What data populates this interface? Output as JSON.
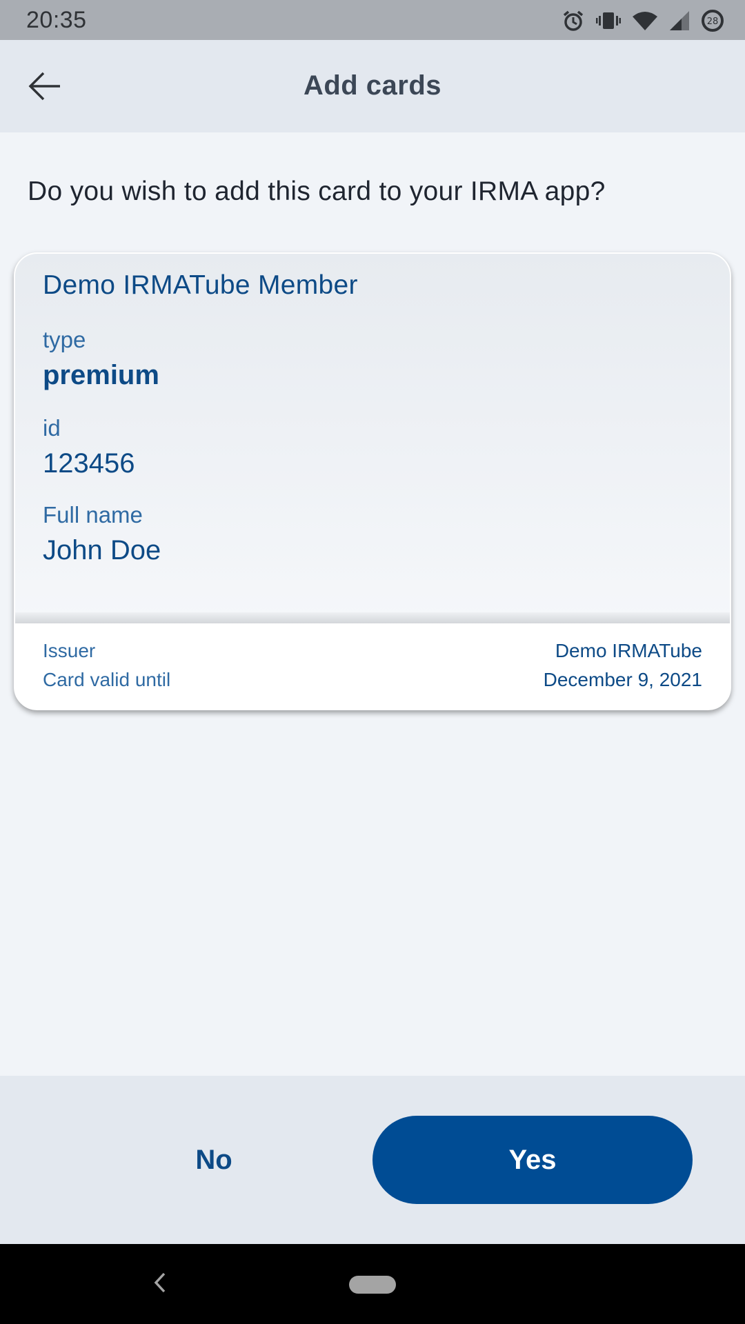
{
  "status_bar": {
    "time": "20:35",
    "icons": [
      "alarm-icon",
      "vibrate-icon",
      "wifi-icon",
      "signal-icon",
      "battery-icon"
    ],
    "battery_level": "28"
  },
  "app_bar": {
    "title": "Add cards",
    "back_icon": "arrow-left-icon"
  },
  "question": "Do you wish to add this card to your IRMA app?",
  "card": {
    "title": "Demo IRMATube Member",
    "attributes": [
      {
        "label": "type",
        "value": "premium"
      },
      {
        "label": "id",
        "value": "123456"
      },
      {
        "label": "Full name",
        "value": "John Doe"
      }
    ],
    "issuer_label": "Issuer",
    "issuer_value": "Demo IRMATube",
    "valid_label": "Card valid until",
    "valid_value": "December 9, 2021"
  },
  "actions": {
    "no_label": "No",
    "yes_label": "Yes"
  },
  "nav": {
    "back_icon": "nav-back-icon",
    "home_icon": "nav-home-pill"
  },
  "colors": {
    "primary": "#004c94",
    "text_blue": "#0d4a86",
    "label_blue": "#2f6aa3",
    "app_bar_bg": "#e3e8ef",
    "page_bg": "#f1f4f8",
    "status_bar_bg": "#a9adb3"
  }
}
